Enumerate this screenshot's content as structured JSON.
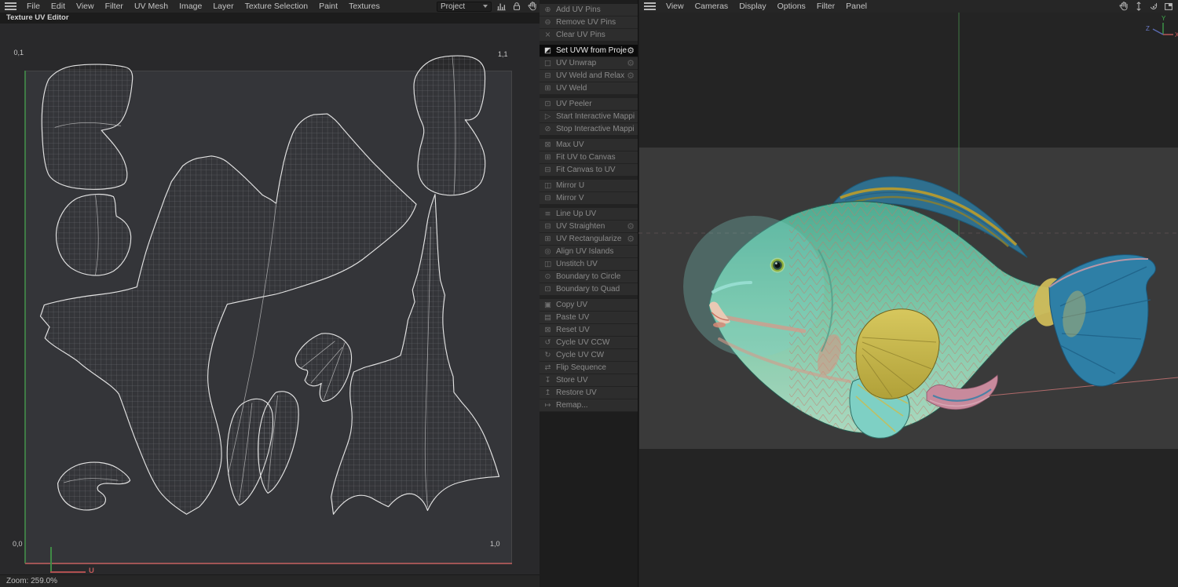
{
  "left": {
    "menu": [
      {
        "label": "File"
      },
      {
        "label": "Edit"
      },
      {
        "label": "View"
      },
      {
        "label": "Filter"
      },
      {
        "label": "UV Mesh"
      },
      {
        "label": "Image"
      },
      {
        "label": "Layer"
      },
      {
        "label": "Texture Selection"
      },
      {
        "label": "Paint"
      },
      {
        "label": "Textures"
      }
    ],
    "subtitle": "Texture UV Editor",
    "project_label": "Project",
    "corners": {
      "tl": "0,1",
      "tr": "1,1",
      "bl": "0,0",
      "br": "1,0"
    },
    "u_label": "U",
    "status_zoom": "Zoom: 259.0%"
  },
  "uv_palette": {
    "items": [
      {
        "icon": "⊕",
        "label": "Add UV Pins"
      },
      {
        "icon": "⊖",
        "label": "Remove UV Pins"
      },
      {
        "icon": "×",
        "label": "Clear UV Pins",
        "classes": "sep"
      },
      {
        "icon": "◩",
        "label": "Set UVW from Projection",
        "gear": "⚙",
        "classes": "active bright"
      },
      {
        "icon": "□",
        "label": "UV Unwrap",
        "gear": "⚙"
      },
      {
        "icon": "⊟",
        "label": "UV Weld and Relax",
        "gear": "⚙"
      },
      {
        "icon": "⊞",
        "label": "UV Weld",
        "classes": "sep"
      },
      {
        "icon": "⊡",
        "label": "UV Peeler"
      },
      {
        "icon": "▷",
        "label": "Start Interactive Mapping"
      },
      {
        "icon": "⊘",
        "label": "Stop Interactive Mapping",
        "classes": "sep"
      },
      {
        "icon": "⊠",
        "label": "Max UV"
      },
      {
        "icon": "⊞",
        "label": "Fit UV to Canvas"
      },
      {
        "icon": "⊟",
        "label": "Fit Canvas to UV",
        "classes": "sep"
      },
      {
        "icon": "◫",
        "label": "Mirror U"
      },
      {
        "icon": "⊟",
        "label": "Mirror V",
        "classes": "sep"
      },
      {
        "icon": "≡",
        "label": "Line Up UV"
      },
      {
        "icon": "⊟",
        "label": "UV Straighten",
        "gear": "⚙"
      },
      {
        "icon": "⊞",
        "label": "UV Rectangularize",
        "gear": "⚙"
      },
      {
        "icon": "◎",
        "label": "Align UV Islands"
      },
      {
        "icon": "◫",
        "label": "Unstitch UV"
      },
      {
        "icon": "⊙",
        "label": "Boundary to Circle"
      },
      {
        "icon": "⊡",
        "label": "Boundary to Quad",
        "classes": "sep"
      },
      {
        "icon": "▣",
        "label": "Copy UV"
      },
      {
        "icon": "▤",
        "label": "Paste UV"
      },
      {
        "icon": "⊠",
        "label": "Reset UV"
      },
      {
        "icon": "↺",
        "label": "Cycle UV CCW"
      },
      {
        "icon": "↻",
        "label": "Cycle UV CW"
      },
      {
        "icon": "⇄",
        "label": "Flip Sequence"
      },
      {
        "icon": "↧",
        "label": "Store UV"
      },
      {
        "icon": "↥",
        "label": "Restore UV"
      },
      {
        "icon": "↦",
        "label": "Remap..."
      }
    ]
  },
  "viewport": {
    "menu": [
      {
        "label": "View"
      },
      {
        "label": "Cameras"
      },
      {
        "label": "Display"
      },
      {
        "label": "Options"
      },
      {
        "label": "Filter"
      },
      {
        "label": "Panel"
      }
    ],
    "axis": {
      "x": "X",
      "y": "Y",
      "z": "Z"
    }
  },
  "colors": {
    "axis_x_red": "#c25a5a",
    "axis_y_green": "#3f8a45",
    "axis_z_blue": "#5a6a9a",
    "uv_u_edge": "#a05555",
    "uv_v_edge": "#3f7a45",
    "wireframe": "#e3e3e3",
    "viewport_band": "#3a3a3a",
    "active_row": "#0b0b0b"
  }
}
